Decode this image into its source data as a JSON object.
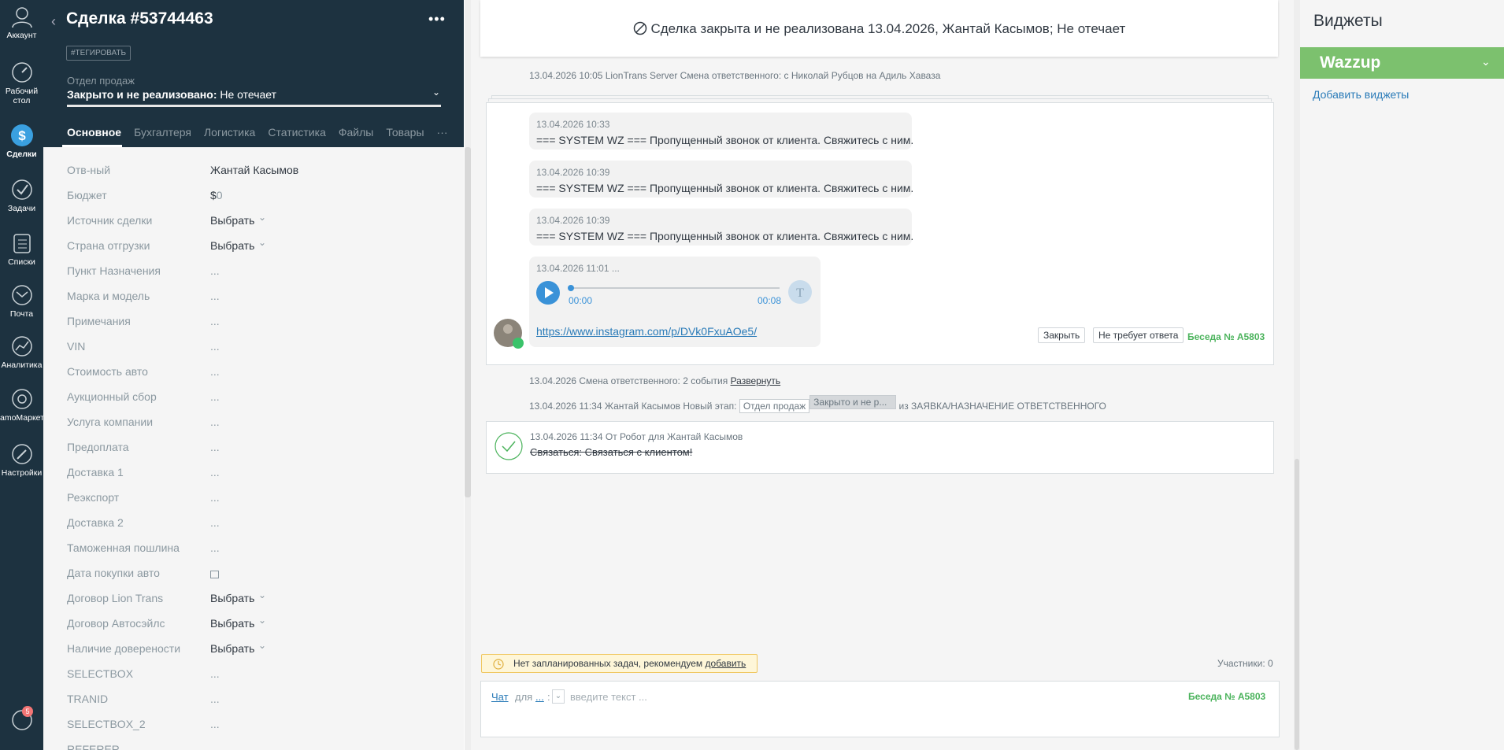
{
  "nav": {
    "items": [
      {
        "label": "Аккаунт"
      },
      {
        "label": "Рабочий стол"
      },
      {
        "label": "Сделки"
      },
      {
        "label": "Задачи"
      },
      {
        "label": "Списки"
      },
      {
        "label": "Почта"
      },
      {
        "label": "Аналитика"
      },
      {
        "label": "amoМаркет"
      },
      {
        "label": "Настройки"
      }
    ],
    "badge": "5"
  },
  "card": {
    "title": "Сделка #53744463",
    "tag_button": "#ТЕГИРОВАТЬ",
    "pipeline_label": "Отдел продаж",
    "status_bold": "Закрыто и не реализовано:",
    "status_reason": "Не отечает",
    "tabs": [
      "Основное",
      "Бухгалтеря",
      "Логистика",
      "Статистика",
      "Файлы",
      "Товары"
    ],
    "more_tabs": "···",
    "fields": [
      {
        "label": "Отв-ный",
        "value": "Жантай Касымов"
      },
      {
        "label": "Бюджет",
        "value": "$0"
      },
      {
        "label": "Источник сделки",
        "value": "Выбрать"
      },
      {
        "label": "Страна отгрузки",
        "value": "Выбрать"
      },
      {
        "label": "Пункт Назначения",
        "value": "..."
      },
      {
        "label": "Марка и модель",
        "value": "..."
      },
      {
        "label": "Примечания",
        "value": "..."
      },
      {
        "label": "VIN",
        "value": "..."
      },
      {
        "label": "Стоимость авто",
        "value": "..."
      },
      {
        "label": "Аукционный сбор",
        "value": "..."
      },
      {
        "label": "Услуга компании",
        "value": "..."
      },
      {
        "label": "Предоплата",
        "value": "..."
      },
      {
        "label": "Доставка 1",
        "value": "..."
      },
      {
        "label": "Реэкспорт",
        "value": "..."
      },
      {
        "label": "Доставка 2",
        "value": "..."
      },
      {
        "label": "Таможенная пошлина",
        "value": "..."
      },
      {
        "label": "Дата покупки авто",
        "value": ""
      },
      {
        "label": "Договор Lion Trans",
        "value": "Выбрать"
      },
      {
        "label": "Договор Автосэйлс",
        "value": "Выбрать"
      },
      {
        "label": "Наличие доверености",
        "value": "Выбрать"
      },
      {
        "label": "SELECTBOX",
        "value": "..."
      },
      {
        "label": "TRANID",
        "value": "..."
      },
      {
        "label": "SELECTBOX_2",
        "value": "..."
      },
      {
        "label": "REFERER",
        "value": ""
      }
    ]
  },
  "feed": {
    "closed_banner": "Сделка закрыта и не реализована 13.04.2026, Жантай Касымов; Не отечает",
    "resp_change": "13.04.2026 10:05 LionTrans Server Смена ответственного: с Николай Рубцов на Адиль Хаваза",
    "messages": [
      {
        "time": "13.04.2026 10:33",
        "text": "=== SYSTEM WZ === Пропущенный звонок от клиента. Свяжитесь с ним."
      },
      {
        "time": "13.04.2026 10:39",
        "text": "=== SYSTEM WZ === Пропущенный звонок от клиента. Свяжитесь с ним."
      },
      {
        "time": "13.04.2026 10:39",
        "text": "=== SYSTEM WZ === Пропущенный звонок от клиента. Свяжитесь с ним."
      }
    ],
    "audio": {
      "time": "13.04.2026 11:01 ...",
      "start": "00:00",
      "end": "00:08",
      "progress": 0
    },
    "link": "https://www.instagram.com/p/DVk0FxuAOe5/",
    "close_btn": "Закрыть",
    "no_reply_btn": "Не требует ответа",
    "conversation": "Беседа № А5803",
    "events_summary_prefix": "13.04.2026 Смена ответственного: 2 события",
    "expand_link": "Развернуть",
    "stage_line_prefix": "13.04.2026 11:34 Жантай Касымов Новый этап:",
    "stage_from": "Отдел продаж",
    "stage_to": "Закрыто и не р...",
    "stage_suffix": "из ЗАЯВКА/НАЗНАЧЕНИЕ ОТВЕТСТВЕННОГО",
    "task_header": "13.04.2026 11:34  От Робот для Жантай Касымов",
    "task_text": "Связаться: Связаться с клиентом!",
    "no_tasks": "Нет запланированных задач, рекомендуем",
    "no_tasks_link": "добавить",
    "participants": "Участники: 0",
    "composer": {
      "chat_link": "Чат",
      "for": "для",
      "recipient": "...",
      "placeholder": "введите текст ...",
      "conversation": "Беседа № А5803"
    }
  },
  "widgets": {
    "title": "Виджеты",
    "wazzup": "Wazzup",
    "add": "Добавить виджеты"
  },
  "colors": {
    "sidebar": "#1d3240",
    "accent_green": "#7cc16e",
    "link_blue": "#2a7bb8",
    "badge_red": "#f37575"
  }
}
